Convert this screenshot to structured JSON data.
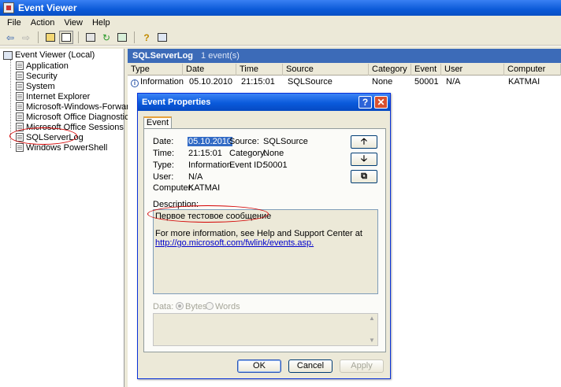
{
  "window": {
    "title": "Event Viewer",
    "icon": "event-viewer-icon"
  },
  "menu": [
    "File",
    "Action",
    "View",
    "Help"
  ],
  "toolbar": {
    "icons": [
      "back-icon",
      "forward-icon",
      "up-folder-icon",
      "show-hide-tree-icon",
      "properties-icon",
      "refresh-icon",
      "export-icon",
      "help-icon",
      "console-icon"
    ]
  },
  "tree": {
    "root": "Event Viewer (Local)",
    "items": [
      "Application",
      "Security",
      "System",
      "Internet Explorer",
      "Microsoft-Windows-Forwarding/",
      "Microsoft Office Diagnostics",
      "Microsoft Office Sessions",
      "SQLServerLog",
      "Windows PowerShell"
    ]
  },
  "list": {
    "title": "SQLServerLog",
    "count": "1 event(s)",
    "columns": [
      "Type",
      "Date",
      "Time",
      "Source",
      "Category",
      "Event",
      "User",
      "Computer"
    ],
    "rows": [
      {
        "type": "Information",
        "date": "05.10.2010",
        "time": "21:15:01",
        "source": "SQLSource",
        "category": "None",
        "event": "50001",
        "user": "N/A",
        "computer": "KATMAI"
      }
    ]
  },
  "dialog": {
    "title": "Event Properties",
    "help_glyph": "?",
    "close_glyph": "✕",
    "tab": "Event",
    "labels": {
      "date": "Date:",
      "time": "Time:",
      "type": "Type:",
      "user": "User:",
      "computer": "Computer:",
      "source": "Source:",
      "category": "Category:",
      "event_id": "Event ID:",
      "description": "Description:",
      "data": "Data:",
      "bytes": "Bytes",
      "words": "Words"
    },
    "values": {
      "date": "05.10.2010",
      "time": "21:15:01",
      "type": "Information",
      "user": "N/A",
      "computer": "KATMAI",
      "source": "SQLSource",
      "category": "None",
      "event_id": "50001"
    },
    "description_line1": "Первое тестовое сообщение",
    "description_line2": "For more information, see Help and Support Center at",
    "description_link": "http://go.microsoft.com/fwlink/events.asp.",
    "nav": {
      "up": "🡡",
      "down": "🡣",
      "copy": "⧉"
    },
    "buttons": {
      "ok": "OK",
      "cancel": "Cancel",
      "apply": "Apply"
    }
  },
  "colors": {
    "title_bar": "#0b5ad8",
    "list_header": "#3c6bb8",
    "highlight_circle": "#d40000",
    "selection": "#316ac5"
  }
}
